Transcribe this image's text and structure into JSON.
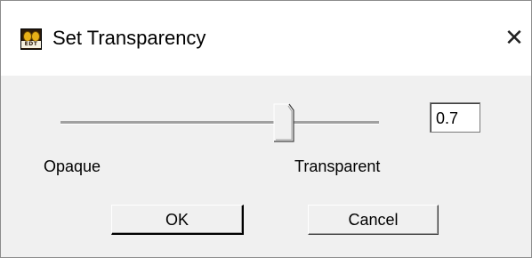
{
  "window": {
    "title": "Set Transparency",
    "app_icon": "edt-app-icon",
    "app_icon_text": "EDT",
    "close_icon": "close-icon"
  },
  "slider": {
    "value_fraction": 0.7,
    "min_label": "Opaque",
    "max_label": "Transparent"
  },
  "value_field": {
    "value": "0.7"
  },
  "buttons": {
    "ok": "OK",
    "cancel": "Cancel"
  }
}
